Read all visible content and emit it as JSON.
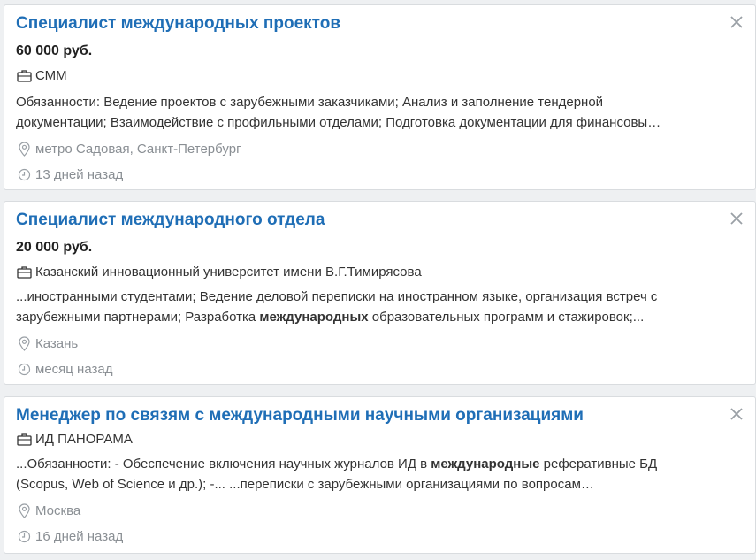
{
  "vacancies": [
    {
      "title": "Специалист международных проектов",
      "salary": "60 000 руб.",
      "company": "СММ",
      "description_lines": [
        "Обязанности: Ведение проектов с зарубежными заказчиками; Анализ и заполнение тендерной",
        "документации; Взаимодействие с профильными отделами; Подготовка документации для финансовы…"
      ],
      "location": "метро Садовая, Санкт-Петербург",
      "posted": "13 дней назад"
    },
    {
      "title": "Специалист международного отдела",
      "salary": "20 000 руб.",
      "company": "Казанский инновационный университет имени В.Г.Тимирясова",
      "description_line1": " ...иностранными студентами; Ведение деловой переписки на иностранном языке, организация встреч с",
      "description_line2_pre": "зарубежными партнерами; Разработка ",
      "description_line2_bold": "международных",
      "description_line2_post": " образовательных программ и стажировок;...",
      "location": "Казань",
      "posted": "месяц назад"
    },
    {
      "title": "Менеджер по связям с международными научными организациями",
      "company": "ИД ПАНОРАМА",
      "description_line1_pre": " ...Обязанности: - Обеспечение включения научных журналов ИД в ",
      "description_line1_bold": "международные",
      "description_line1_post": " реферативные БД",
      "description_line2": "(Scopus, Web of Science и др.); -...  ...переписки с зарубежными организациями по вопросам…",
      "location": "Москва",
      "posted": "16 дней назад"
    }
  ],
  "icons": {
    "company": "briefcase-icon",
    "location": "map-pin-icon",
    "posted": "clock-icon",
    "dismiss": "close-icon"
  },
  "colors": {
    "title": "#1f6eb6",
    "muted": "#8a8f94",
    "background": "#eef0f2"
  }
}
